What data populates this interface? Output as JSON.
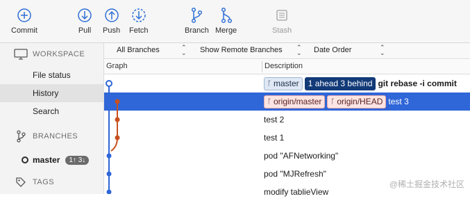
{
  "toolbar": {
    "commit": "Commit",
    "pull": "Pull",
    "push": "Push",
    "fetch": "Fetch",
    "branch": "Branch",
    "merge": "Merge",
    "stash": "Stash"
  },
  "sidebar": {
    "workspace": "WORKSPACE",
    "items": [
      "File status",
      "History",
      "Search"
    ],
    "branches": "BRANCHES",
    "branch_name": "master",
    "branch_status": "1↑ 3↓",
    "tags": "TAGS"
  },
  "filter": {
    "branches": "All Branches",
    "remote": "Show Remote Branches",
    "order": "Date Order"
  },
  "columns": {
    "graph": "Graph",
    "description": "Description"
  },
  "commits": [
    {
      "tags": [
        "master",
        "1 ahead 3 behind"
      ],
      "message": "git rebase -i commit"
    },
    {
      "tags": [
        "origin/master",
        "origin/HEAD"
      ],
      "message": "test 3"
    },
    {
      "message": "test 2"
    },
    {
      "message": "test 1"
    },
    {
      "message": "pod \"AFNetworking\""
    },
    {
      "message": "pod \"MJRefresh\""
    },
    {
      "message": "modify tablieView"
    }
  ],
  "watermark": "@稀土掘金技术社区",
  "colors": {
    "selection": "#2f66d8",
    "local_branch": "#2f66d8",
    "remote_branch": "#c8501e"
  }
}
